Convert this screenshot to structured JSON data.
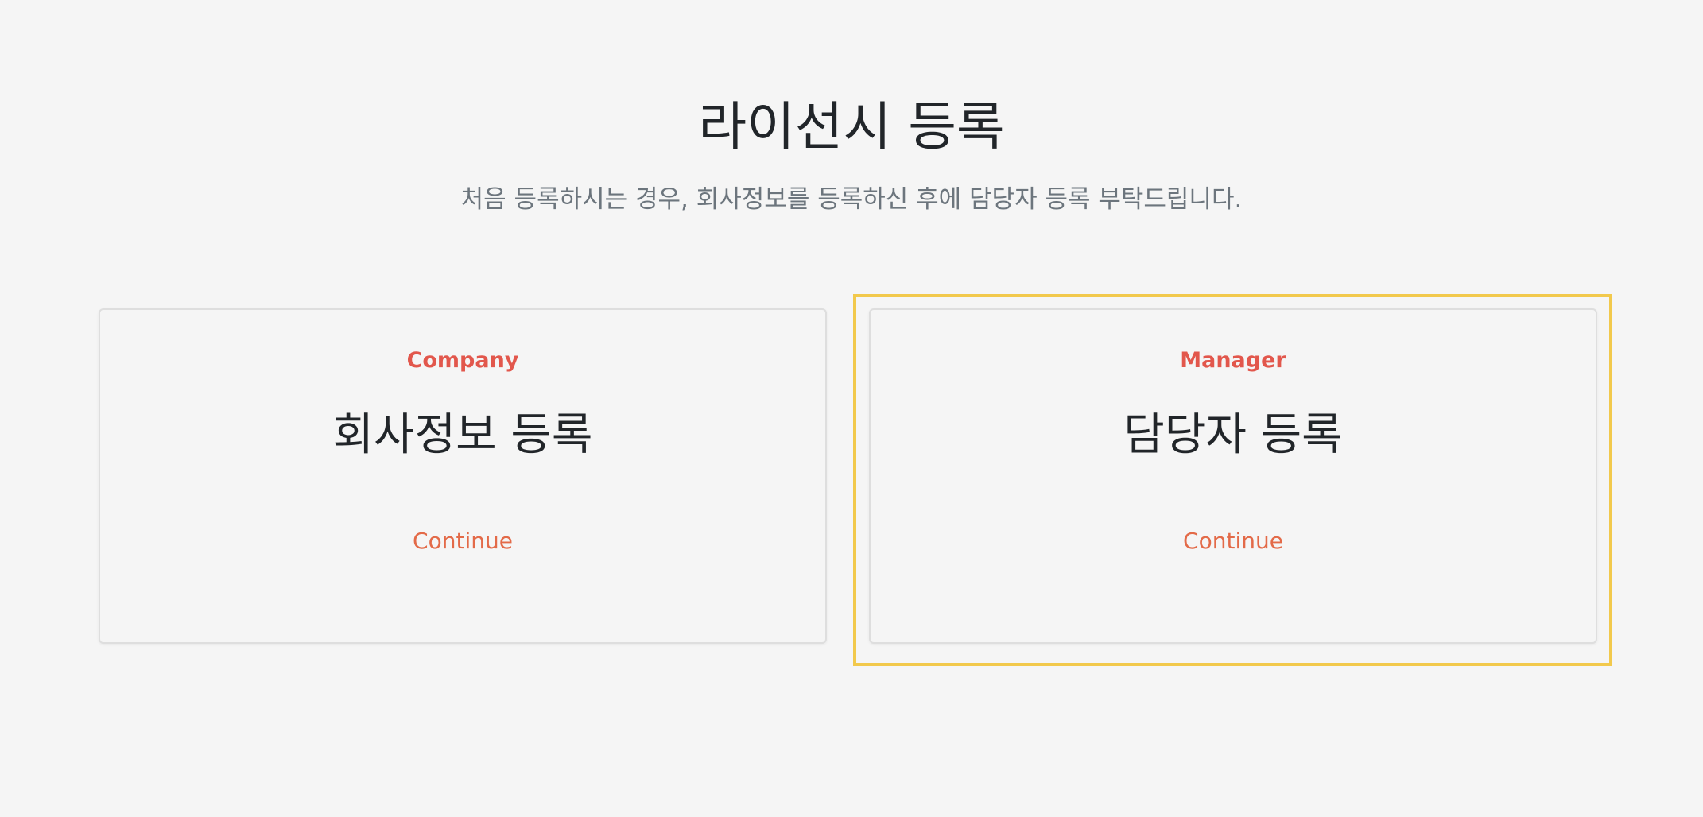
{
  "header": {
    "title": "라이선시 등록",
    "subtitle": "처음 등록하시는 경우, 회사정보를 등록하신 후에 담당자 등록 부탁드립니다."
  },
  "cards": [
    {
      "eyebrow": "Company",
      "title": "회사정보 등록",
      "action_label": "Continue"
    },
    {
      "eyebrow": "Manager",
      "title": "담당자 등록",
      "action_label": "Continue"
    }
  ],
  "colors": {
    "background": "#f5f5f5",
    "accent_label": "#e2574c",
    "action_link": "#e36a48",
    "focus_outline": "#f2c94c",
    "title_text": "#212529",
    "subtitle_text": "#6c757d"
  }
}
